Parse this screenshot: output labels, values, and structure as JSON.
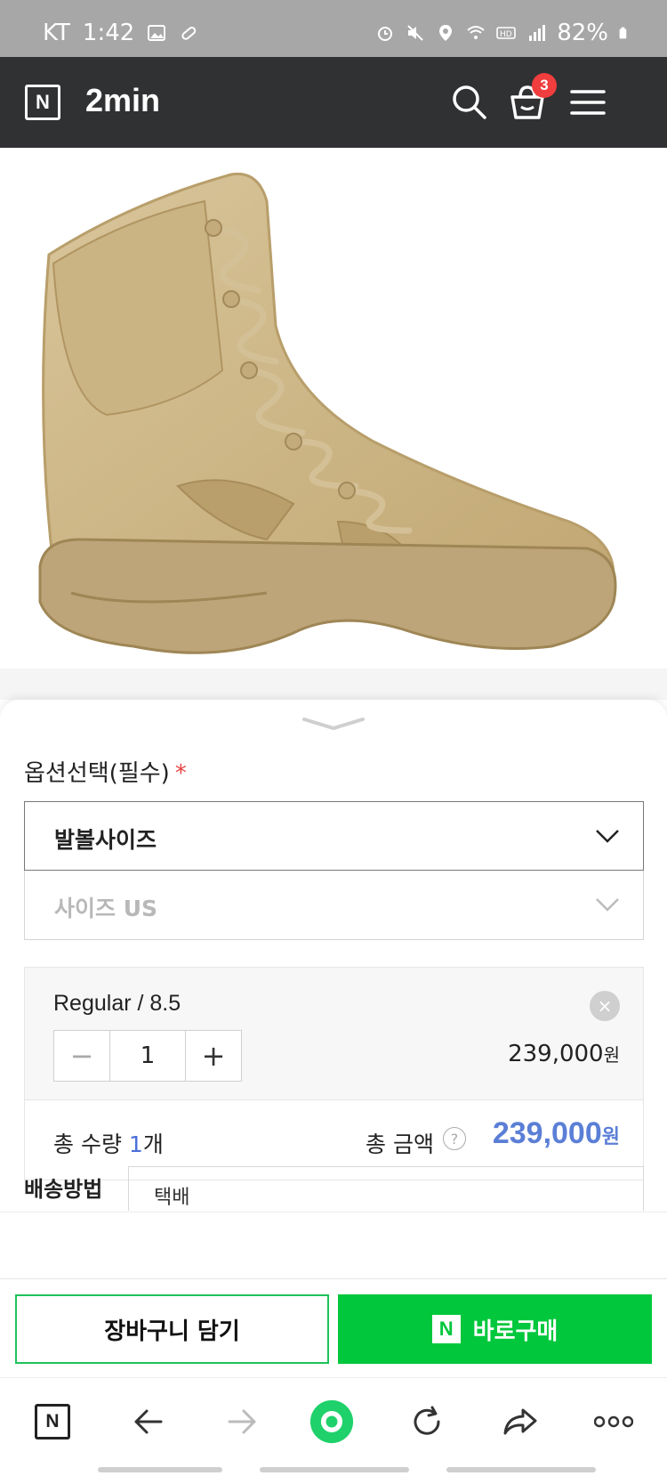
{
  "status_bar": {
    "carrier": "KT",
    "time": "1:42",
    "battery": "82%"
  },
  "header": {
    "logo_letter": "N",
    "store_name": "2min",
    "cart_count": "3"
  },
  "option": {
    "title": "옵션선택(필수)",
    "required_mark": "*",
    "select1_value": "발볼사이즈",
    "select2_placeholder": "사이즈 US"
  },
  "selected_item": {
    "name": "Regular / 8.5",
    "qty": "1",
    "minus": "−",
    "plus": "+",
    "price": "239,000",
    "price_unit": "원",
    "close": "×"
  },
  "totals": {
    "qty_label": "총 수량",
    "qty_value": "1",
    "qty_unit": "개",
    "amount_label": "총 금액",
    "help": "?",
    "amount": "239,000",
    "amount_unit": "원"
  },
  "shipping": {
    "label": "배송방법",
    "value": "택배"
  },
  "actions": {
    "cart_label": "장바구니 담기",
    "buy_icon": "N",
    "buy_label": "바로구매"
  },
  "browser_nav": {
    "home_letter": "N"
  },
  "colors": {
    "header_bg": "#303133",
    "buy_green": "#00c73c",
    "price_blue": "#5b7fd6",
    "badge_red": "#f03d3d"
  }
}
